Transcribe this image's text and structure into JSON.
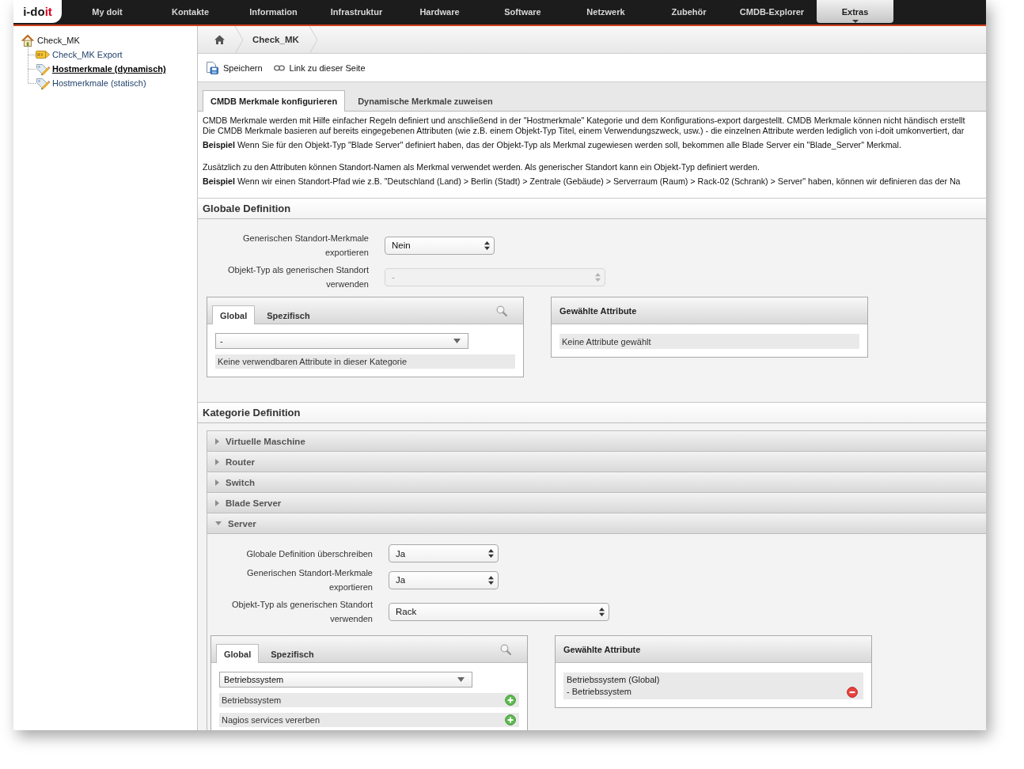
{
  "top_nav": {
    "logo": [
      {
        "text": "i-do",
        "color": "#1a1a1a"
      },
      {
        "text": "it",
        "color": "#e2001a"
      }
    ],
    "items": [
      {
        "label": "My doit",
        "selected": false
      },
      {
        "label": "Kontakte",
        "selected": false
      },
      {
        "label": "Information",
        "selected": false
      },
      {
        "label": "Infrastruktur",
        "selected": false
      },
      {
        "label": "Hardware",
        "selected": false
      },
      {
        "label": "Software",
        "selected": false
      },
      {
        "label": "Netzwerk",
        "selected": false
      },
      {
        "label": "Zubehör",
        "selected": false
      },
      {
        "label": "CMDB-Explorer",
        "selected": false
      },
      {
        "label": "Extras",
        "selected": true
      }
    ]
  },
  "sidebar": {
    "tree": [
      {
        "label": "Check_MK",
        "selected": false,
        "children": [
          {
            "kind": "export",
            "label": "Check_MK Export",
            "selected": false
          },
          {
            "kind": "rule",
            "label": "Hostmerkmale (dynamisch)",
            "selected": true
          },
          {
            "kind": "rule",
            "label": "Hostmerkmale (statisch)",
            "selected": false
          }
        ]
      }
    ]
  },
  "breadcrumb": {
    "items": [
      "Check_MK"
    ]
  },
  "toolbar": {
    "buttons": [
      {
        "kind": "save",
        "label": "Speichern"
      },
      {
        "kind": "link",
        "label": "Link zu dieser Seite"
      }
    ]
  },
  "tabs": [
    {
      "label": "CMDB Merkmale konfigurieren",
      "selected": true
    },
    {
      "label": "Dynamische Merkmale zuweisen",
      "selected": false
    }
  ],
  "intro": [
    {
      "paragraphs": [
        {
          "lines": [
            "CMDB Merkmale werden mit Hilfe einfacher Regeln definiert und anschließend in der \"Hostmerkmale\" Kategorie und dem Konfigurations-export dargestellt. CMDB Merkmale können nicht händisch erstellt",
            "Die CMDB Merkmale basieren auf bereits eingegebenen Attributen (wie z.B. einem Objekt-Typ Titel, einem Verwendungszweck, usw.) - die einzelnen Attribute werden lediglich von i-doit umkonvertiert, dar"
          ]
        },
        {
          "lines": [
            "**Beispiel** Wenn Sie für den Objekt-Typ \"Blade Server\" definiert haben, das der Objekt-Typ als Merkmal zugewiesen werden soll, bekommen alle Blade Server ein \"Blade_Server\" Merkmal."
          ]
        }
      ]
    },
    {
      "paragraphs": [
        {
          "lines": [
            "Zusätzlich zu den Attributen können Standort-Namen als Merkmal verwendet werden. Als generischer Standort kann ein Objekt-Typ definiert werden."
          ]
        },
        {
          "lines": [
            "**Beispiel** Wenn wir einen Standort-Pfad wie z.B. \"Deutschland (Land) > Berlin (Stadt) > Zentrale (Gebäude) > Serverraum (Raum) > Rack-02 (Schrank) > Server\" haben, können wir definieren das der Na"
          ]
        }
      ]
    }
  ],
  "global_definition": {
    "title": "Globale Definition",
    "fields": [
      {
        "kind": "yes_no",
        "label": "Generischen Standort-Merkmale exportieren",
        "value": "Nein",
        "disabled": false
      },
      {
        "kind": "object_type",
        "label": "Objekt-Typ als generischen Standort verwenden",
        "value": "-",
        "disabled": true
      }
    ],
    "attribute_picker": {
      "tabs": [
        {
          "label": "Global",
          "selected": true
        },
        {
          "label": "Spezifisch",
          "selected": false
        }
      ],
      "select": {
        "value": "-"
      },
      "items": [
        {
          "kind": "empty",
          "label": "Keine verwendbaren Attribute in dieser Kategorie"
        }
      ]
    },
    "selected_attributes": {
      "title": "Gewählte Attribute",
      "items": [
        {
          "kind": "empty",
          "label": "Keine Attribute gewählt"
        }
      ]
    }
  },
  "category_definition": {
    "title": "Kategorie Definition",
    "categories": [
      {
        "label": "Virtuelle Maschine",
        "expanded": false
      },
      {
        "label": "Router",
        "expanded": false
      },
      {
        "label": "Switch",
        "expanded": false
      },
      {
        "label": "Blade Server",
        "expanded": false
      },
      {
        "label": "Server",
        "expanded": true,
        "fields": [
          {
            "kind": "yes_no",
            "label": "Globale Definition überschreiben",
            "value": "Ja",
            "disabled": false
          },
          {
            "kind": "yes_no",
            "label": "Generischen Standort-Merkmale exportieren",
            "value": "Ja",
            "disabled": false
          },
          {
            "kind": "object_type",
            "label": "Objekt-Typ als generischen Standort verwenden",
            "value": "Rack",
            "disabled": false
          }
        ],
        "attribute_picker": {
          "tabs": [
            {
              "label": "Global",
              "selected": true
            },
            {
              "label": "Spezifisch",
              "selected": false
            }
          ],
          "select": {
            "value": "Betriebssystem"
          },
          "items": [
            {
              "kind": "attribute",
              "label": "Betriebssystem"
            },
            {
              "kind": "attribute",
              "label": "Nagios services vererben"
            }
          ]
        },
        "selected_attributes": {
          "title": "Gewählte Attribute",
          "items": [
            {
              "kind": "attribute",
              "label": "Betriebssystem (Global)",
              "detail": "- Betriebssystem"
            }
          ]
        }
      }
    ]
  }
}
